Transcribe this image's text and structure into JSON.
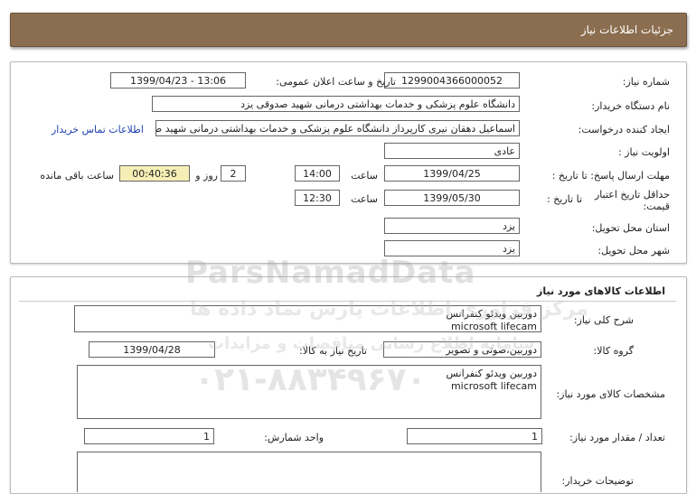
{
  "header": {
    "title": "جزئیات اطلاعات نیاز"
  },
  "info": {
    "need_number_label": "شماره نیاز:",
    "need_number": "1299004366000052",
    "announce_label": "تاریخ و ساعت اعلان عمومی:",
    "announce_value": "1399/04/23 - 13:06",
    "buyer_label": "نام دستگاه خریدار:",
    "buyer_value": "دانشگاه علوم پزشکی و خدمات بهداشتی درمانی شهید صدوقی یزد",
    "creator_label": "ایجاد کننده درخواست:",
    "creator_value": "اسماعیل دهقان نیری کارپرداز دانشگاه علوم پزشکی و خدمات بهداشتی درمانی شهید صدوقی یزد",
    "contact_link": "اطلاعات تماس خریدار",
    "priority_label": "اولویت نیاز :",
    "priority_value": "عادی",
    "deadline_label": "مهلت ارسال پاسخ: تا تاریخ :",
    "deadline_date": "1399/04/25",
    "time_label": "ساعت",
    "deadline_time": "14:00",
    "days_value": "2",
    "days_label": "روز و",
    "remaining_time": "00:40:36",
    "remaining_label": "ساعت باقی مانده",
    "validity_label": "حداقل تاریخ اعتبار قیمت:",
    "validity_to_label": "تا تاریخ :",
    "validity_date": "1399/05/30",
    "validity_time": "12:30",
    "province_label": "استان محل تحویل:",
    "province_value": "یزد",
    "city_label": "شهر محل تحویل:",
    "city_value": "یزد"
  },
  "goods": {
    "section_title": "اطلاعات کالاهای مورد نیاز",
    "desc_label": "شرح کلی نیاز:",
    "desc_line1": "دوربین ویدئو کنفرانس",
    "desc_line2": "microsoft lifecam",
    "group_label": "گروه کالا:",
    "group_value": "دوربین،صوتی و تصویر",
    "need_date_label": "تاریخ نیاز به کالا:",
    "need_date_value": "1399/04/28",
    "spec_label": "مشخصات کالای مورد نیاز:",
    "spec_line1": "دوربین ویدئو کنفرانس",
    "spec_line2": "microsoft lifecam",
    "qty_label": "تعداد / مقدار مورد نیاز:",
    "qty_value": "1",
    "unit_label": "واحد شمارش:",
    "unit_value": "1",
    "buyer_notes_label": "توضیحات خریدار:",
    "buyer_notes_value": ""
  },
  "watermark": {
    "brand": "ParsNamadData",
    "tagline": "مرکز فراوری اطلاعات پارس نماد داده ها",
    "tagline2": "سامانه اطلاع رسانی مناقصات و مزایدات",
    "phone": "۰۲۱-۸۸۳۴۹۶۷۰"
  }
}
